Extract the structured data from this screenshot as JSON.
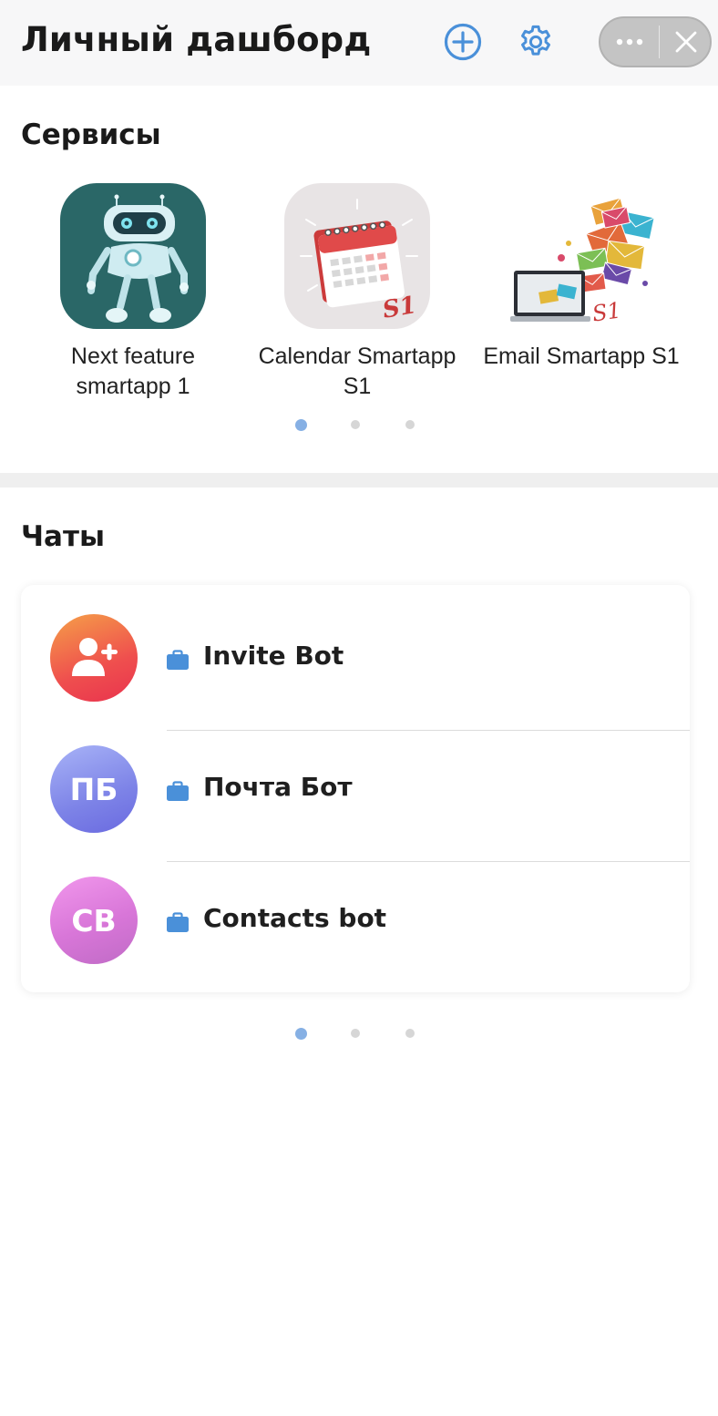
{
  "header": {
    "title": "Личный дашборд",
    "add_icon": "plus-circle-icon",
    "settings_icon": "gear-icon",
    "more_icon": "more-dots-icon",
    "close_icon": "close-icon",
    "accent_color": "#4a90d9"
  },
  "services": {
    "title": "Сервисы",
    "items": [
      {
        "label": "Next feature smartapp 1",
        "icon": "robot-icon"
      },
      {
        "label": "Calendar Smartapp S1",
        "icon": "calendar-icon"
      },
      {
        "label": "Email Smartapp S1",
        "icon": "email-icon"
      }
    ],
    "pager": {
      "pages": 3,
      "active": 1
    }
  },
  "chats": {
    "title": "Чаты",
    "items": [
      {
        "name": "Invite Bot",
        "avatar_text": "",
        "avatar_icon": "add-user-icon",
        "type_icon": "briefcase-icon"
      },
      {
        "name": "Почта Бот",
        "avatar_text": "ПБ",
        "type_icon": "briefcase-icon"
      },
      {
        "name": "Contacts bot",
        "avatar_text": "CB",
        "type_icon": "briefcase-icon"
      }
    ],
    "pager": {
      "pages": 3,
      "active": 1
    }
  }
}
